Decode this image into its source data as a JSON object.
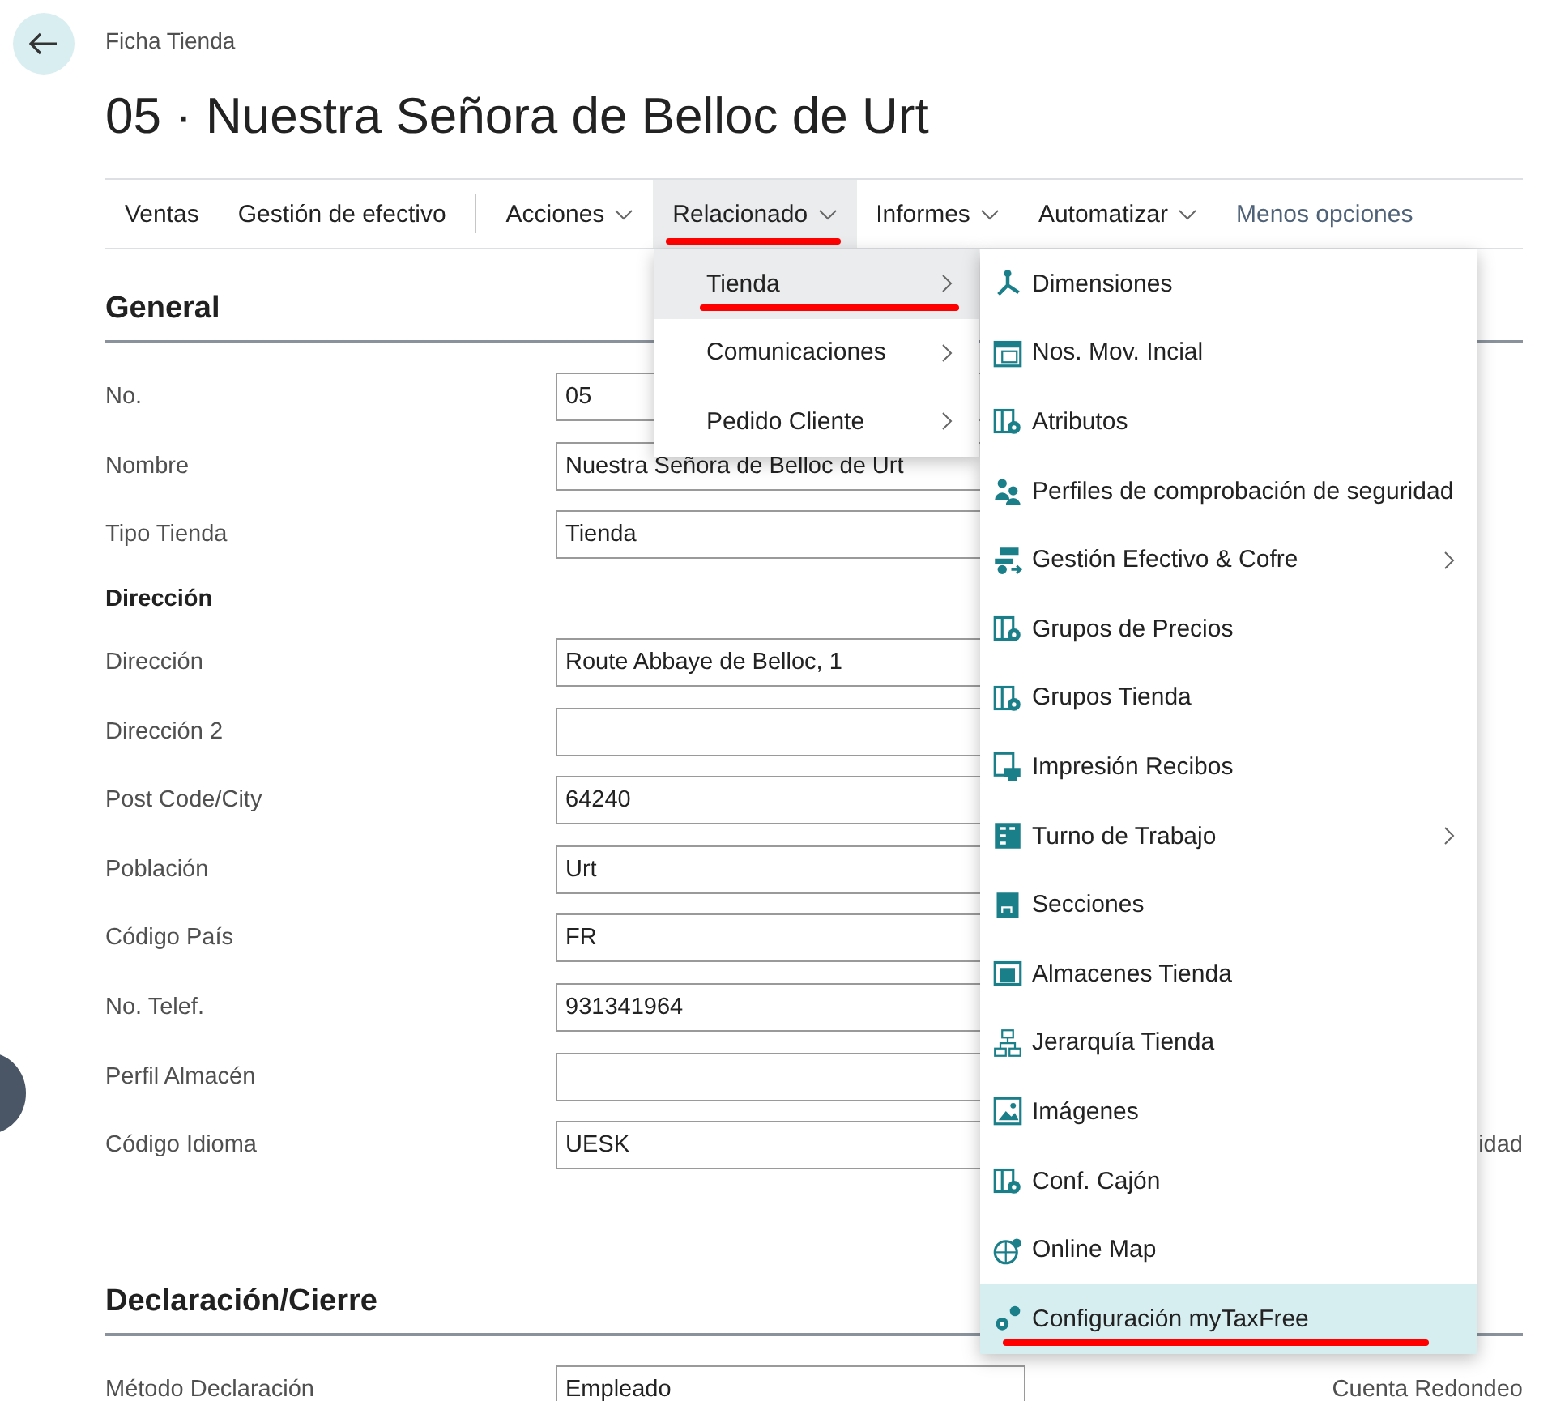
{
  "breadcrumb": "Ficha Tienda",
  "title": "05 · Nuestra Señora de Belloc de Urt",
  "actions": [
    {
      "label": "Ventas",
      "kind": "plain",
      "selected": false,
      "annotated": false
    },
    {
      "label": "Gestión de efectivo",
      "kind": "plain",
      "selected": false,
      "annotated": false
    },
    {
      "kind": "separator"
    },
    {
      "label": "Acciones",
      "kind": "dropdown",
      "selected": false,
      "annotated": false
    },
    {
      "label": "Relacionado",
      "kind": "dropdown",
      "selected": true,
      "annotated": true
    },
    {
      "label": "Informes",
      "kind": "dropdown",
      "selected": false,
      "annotated": false
    },
    {
      "label": "Automatizar",
      "kind": "dropdown",
      "selected": false,
      "annotated": false
    },
    {
      "label": "Menos opciones",
      "kind": "link",
      "selected": false,
      "annotated": false
    }
  ],
  "sections": [
    {
      "title": "General",
      "rows": [
        {
          "kind": "field",
          "label": "No.",
          "value": "05"
        },
        {
          "kind": "field",
          "label": "Nombre",
          "value": "Nuestra Señora de Belloc de Urt"
        },
        {
          "kind": "field",
          "label": "Tipo Tienda",
          "value": "Tienda"
        },
        {
          "kind": "subheading",
          "label": "Dirección"
        },
        {
          "kind": "field",
          "label": "Dirección",
          "value": "Route Abbaye de Belloc, 1"
        },
        {
          "kind": "field",
          "label": "Dirección 2"
        },
        {
          "kind": "field",
          "label": "Post Code/City",
          "value": "64240"
        },
        {
          "kind": "field",
          "label": "Población",
          "value": "Urt"
        },
        {
          "kind": "field",
          "label": "Código País",
          "value": "FR"
        },
        {
          "kind": "field",
          "label": "No. Telef.",
          "value": "931341964"
        },
        {
          "kind": "field",
          "label": "Perfil Almacén"
        },
        {
          "kind": "field",
          "label": "Código Idioma",
          "value": "UESK",
          "right_label": "idad"
        }
      ]
    },
    {
      "title": "Declaración/Cierre",
      "rows": [
        {
          "kind": "field",
          "label": "Método Declaración",
          "value": "Empleado",
          "right_label": "Cuenta Redondeo"
        }
      ]
    }
  ],
  "menu": [
    {
      "label": "Tienda",
      "submenu": true,
      "selected": true,
      "annotated": true
    },
    {
      "label": "Comunicaciones",
      "submenu": true,
      "selected": false,
      "annotated": false
    },
    {
      "label": "Pedido Cliente",
      "submenu": true,
      "selected": false,
      "annotated": false
    }
  ],
  "submenu": [
    {
      "label": "Dimensiones",
      "submenu": false,
      "selected": false,
      "annotated": false
    },
    {
      "label": "Nos. Mov. Incial",
      "submenu": false,
      "selected": false,
      "annotated": false
    },
    {
      "label": "Atributos",
      "submenu": false,
      "selected": false,
      "annotated": false
    },
    {
      "label": "Perfiles de comprobación de seguridad",
      "submenu": false,
      "selected": false,
      "annotated": false
    },
    {
      "label": "Gestión Efectivo & Cofre",
      "submenu": true,
      "selected": false,
      "annotated": false
    },
    {
      "label": "Grupos de Precios",
      "submenu": false,
      "selected": false,
      "annotated": false
    },
    {
      "label": "Grupos Tienda",
      "submenu": false,
      "selected": false,
      "annotated": false
    },
    {
      "label": "Impresión Recibos",
      "submenu": false,
      "selected": false,
      "annotated": false
    },
    {
      "label": "Turno de Trabajo",
      "submenu": true,
      "selected": false,
      "annotated": false
    },
    {
      "label": "Secciones",
      "submenu": false,
      "selected": false,
      "annotated": false
    },
    {
      "label": "Almacenes Tienda",
      "submenu": false,
      "selected": false,
      "annotated": false
    },
    {
      "label": "Jerarquía Tienda",
      "submenu": false,
      "selected": false,
      "annotated": false
    },
    {
      "label": "Imágenes",
      "submenu": false,
      "selected": false,
      "annotated": false
    },
    {
      "label": "Conf. Cajón",
      "submenu": false,
      "selected": false,
      "annotated": false
    },
    {
      "label": "Online Map",
      "submenu": false,
      "selected": false,
      "annotated": false
    },
    {
      "label": "Configuración myTaxFree",
      "submenu": false,
      "selected": true,
      "annotated": true
    }
  ]
}
